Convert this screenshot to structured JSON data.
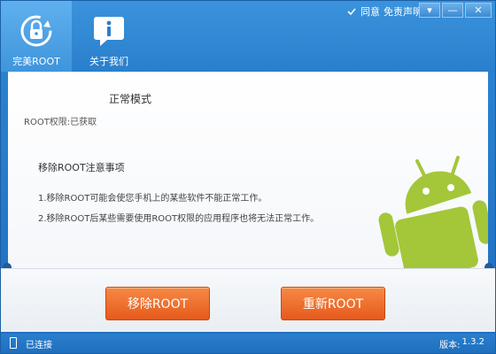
{
  "header": {
    "agree_label": "同意",
    "disclaimer_label": "免责声明",
    "nav": [
      {
        "label": "完美ROOT",
        "icon": "lock-refresh-icon"
      },
      {
        "label": "关于我们",
        "icon": "info-icon"
      }
    ]
  },
  "content": {
    "mode_title": "正常模式",
    "root_status": "ROOT权限:已获取",
    "note_title": "移除ROOT注意事项",
    "notes": [
      "1.移除ROOT可能会使您手机上的某些软件不能正常工作。",
      "2.移除ROOT后某些需要使用ROOT权限的应用程序也将无法正常工作。"
    ]
  },
  "actions": {
    "remove_root": "移除ROOT",
    "reroot": "重新ROOT"
  },
  "status": {
    "connection": "已连接",
    "version_label": "版本:",
    "version": "1.3.2"
  },
  "colors": {
    "titlebar_blue": "#2a7fcc",
    "button_orange": "#e65a1c",
    "android_green": "#a4c639"
  }
}
